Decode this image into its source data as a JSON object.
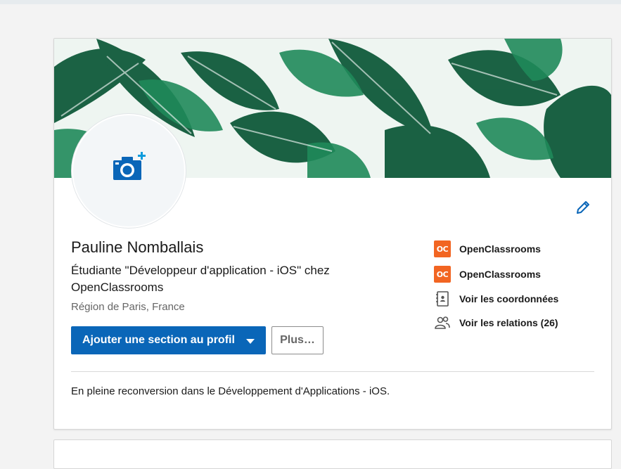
{
  "profile": {
    "name": "Pauline Nomballais",
    "headline": "Étudiante \"Développeur d'application - iOS\" chez OpenClassrooms",
    "location": "Région de Paris, France",
    "summary": "En pleine reconversion dans le Développement d'Applications - iOS."
  },
  "actions": {
    "add_section_label": "Ajouter une section au profil",
    "more_label": "Plus…"
  },
  "side_links": [
    {
      "label": "OpenClassrooms",
      "icon": "openclassrooms-logo"
    },
    {
      "label": "OpenClassrooms",
      "icon": "openclassrooms-logo"
    },
    {
      "label": "Voir les coordonnées",
      "icon": "contact-card-icon"
    },
    {
      "label": "Voir les relations (26)",
      "icon": "people-icon"
    }
  ],
  "colors": {
    "primary": "#0a66b8",
    "openclassrooms": "#f26522",
    "banner_leaf_dark": "#0f5a3a",
    "banner_leaf_light": "#1f8a5a"
  },
  "icons": {
    "avatar": "camera-add-icon",
    "edit": "pencil-icon",
    "dropdown": "caret-down-icon"
  }
}
